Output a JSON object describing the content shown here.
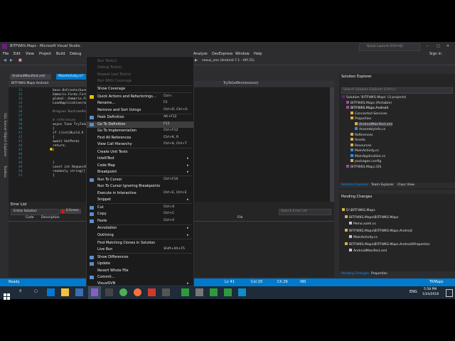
{
  "window": {
    "title": "BITFWKS.Maps - Microsoft Visual Studio",
    "quick_launch": "Quick Launch (Ctrl+Q)",
    "sign_in": "Sign in"
  },
  "menubar": [
    "File",
    "Edit",
    "View",
    "Project",
    "Build",
    "Debug",
    "Team",
    "Format",
    "Tools",
    "VisualSVN",
    "Architecture",
    "Test",
    "Analyze",
    "DevExpress",
    "Window",
    "Help"
  ],
  "toolbar": {
    "device": "nexus_one (Android 7.1 - API 25)"
  },
  "editor": {
    "tabs": [
      "AndroidManifest.xml",
      "MainActivity.cs*"
    ],
    "nav_left": "BITFWKS.Maps.Android",
    "nav_right": "TryToGetPermissions()",
    "line_numbers": [
      "31",
      "32",
      "33",
      "34",
      "35",
      "36",
      "37",
      "38",
      "39",
      "40",
      "41",
      "42",
      "43",
      "44",
      "45",
      "46",
      "47",
      "48",
      "49",
      "50",
      "51"
    ],
    "code_lines": [
      "base.OnCreate(bundl",
      "Xamarin.Forms.Form",
      "global::Xamarin.Fo",
      "LoadApplication(ne",
      "",
      "#region RuntimePermission",
      "",
      "0 references",
      "async Task TryToGet",
      "{",
      "  if ((int)Build.V",
      "  {",
      "    await GetPermi",
      "    return;",
      "  }",
      "",
      "",
      "}",
      "const int RequestLoc",
      "readonly string[] Pe",
      "{"
    ],
    "zoom": "100 %"
  },
  "side_tabs": [
    "SQL Server Object Explorer",
    "Toolbox"
  ],
  "context_menu": {
    "items": [
      {
        "label": "Run Test(s)",
        "shortcut": "",
        "disabled": true
      },
      {
        "label": "Debug Test(s)",
        "shortcut": "",
        "disabled": true
      },
      {
        "label": "Repeat Last Test(s)",
        "shortcut": "",
        "disabled": true
      },
      {
        "label": "Run With Coverage",
        "shortcut": "",
        "disabled": true
      },
      {
        "label": "Show Coverage",
        "shortcut": ""
      },
      {
        "label": "Quick Actions and Refactorings...",
        "shortcut": "Ctrl+."
      },
      {
        "label": "Rename...",
        "shortcut": "F2"
      },
      {
        "label": "Remove and Sort Usings",
        "shortcut": "Ctrl+R, Ctrl+G"
      },
      {
        "label": "Peek Definition",
        "shortcut": "Alt+F12"
      },
      {
        "label": "Go To Definition",
        "shortcut": "F12"
      },
      {
        "label": "Go To Implementation",
        "shortcut": "Ctrl+F12"
      },
      {
        "label": "Find All References",
        "shortcut": "Ctrl+K, R"
      },
      {
        "label": "View Call Hierarchy",
        "shortcut": "Ctrl+K, Ctrl+T"
      },
      {
        "label": "Create Unit Tests",
        "shortcut": ""
      },
      {
        "label": "IntelliTest",
        "shortcut": "",
        "submenu": true
      },
      {
        "label": "Code Map",
        "shortcut": "",
        "submenu": true
      },
      {
        "label": "Breakpoint",
        "shortcut": "",
        "submenu": true
      },
      {
        "label": "Run To Cursor",
        "shortcut": "Ctrl+F10"
      },
      {
        "label": "Run To Cursor Ignoring Breakpoints",
        "shortcut": ""
      },
      {
        "label": "Execute in Interactive",
        "shortcut": "Ctrl+E, Ctrl+E"
      },
      {
        "label": "Snippet",
        "shortcut": "",
        "submenu": true
      },
      {
        "label": "Cut",
        "shortcut": "Ctrl+X"
      },
      {
        "label": "Copy",
        "shortcut": "Ctrl+C"
      },
      {
        "label": "Paste",
        "shortcut": "Ctrl+V"
      },
      {
        "label": "Annotation",
        "shortcut": "",
        "submenu": true
      },
      {
        "label": "Outlining",
        "shortcut": "",
        "submenu": true
      },
      {
        "label": "Find Matching Clones in Solution",
        "shortcut": ""
      },
      {
        "label": "Live Run",
        "shortcut": "Shift+Alt+F5"
      },
      {
        "label": "Show Differences",
        "shortcut": ""
      },
      {
        "label": "Update",
        "shortcut": ""
      },
      {
        "label": "Revert Whole File",
        "shortcut": ""
      },
      {
        "label": "Commit...",
        "shortcut": ""
      },
      {
        "label": "VisualSVN",
        "shortcut": "",
        "submenu": true
      }
    ],
    "highlighted": "Go To Definition"
  },
  "error_list": {
    "title": "Error List",
    "scope": "Entire Solution",
    "errors": "0 Errors",
    "search": "Search Error List",
    "columns": [
      "Code",
      "Description",
      "File"
    ]
  },
  "solution_explorer": {
    "title": "Solution Explorer",
    "search": "Search Solution Explorer (Ctrl+;)",
    "items": [
      "Solution 'BITFWKS.Maps' (3 projects)",
      "BITFWKS.Maps (Portable)",
      "BITFWKS.Maps.Android",
      "Connected Services",
      "Properties",
      "AndroidManifest.xml",
      "AssemblyInfo.cs",
      "References",
      "Assets",
      "Resources",
      "MainActivity.cs",
      "MainApplication.cs",
      "packages.config",
      "BITFWKS.Maps.iOS"
    ],
    "tabs": [
      "Solution Explorer",
      "Team Explorer",
      "Class View"
    ]
  },
  "pending_changes": {
    "title": "Pending Changes",
    "items": [
      "D:\\BITFWKS.Maps",
      "BITFWKS.Maps\\BITFWKS.Maps",
      "Pemo.xaml.cs",
      "BITFWKS.Maps\\BITFWKS.Maps.Android",
      "MainActivity.cs",
      "BITFWKS.Maps\\BITFWKS.Maps.Android\\Properties",
      "AndroidManifest.xml"
    ],
    "tabs": [
      "Pending Changes",
      "Properties"
    ]
  },
  "statusbar": {
    "ready": "Ready",
    "ln": "Ln 41",
    "col": "Col 29",
    "ch": "Ch 29",
    "ins": "INS",
    "branch": "TKMaps"
  },
  "taskbar": {
    "time": "5:58 PM",
    "date": "1/24/2018",
    "lang": "ENG"
  },
  "colors": {
    "accent": "#68217a",
    "status": "#007acc",
    "menu_bg": "#1b1b1c",
    "editor_bg": "#1e1e1e"
  }
}
